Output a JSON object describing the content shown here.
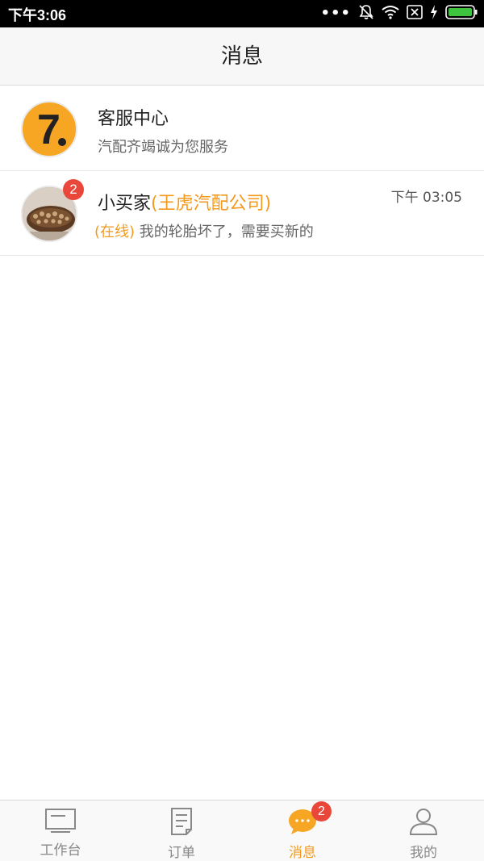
{
  "status_bar": {
    "time": "下午3:06",
    "icons": [
      "more-icon",
      "bell-muted-icon",
      "wifi-icon",
      "no-sim-icon",
      "charging-icon",
      "battery-icon"
    ]
  },
  "header": {
    "title": "消息"
  },
  "conversations": [
    {
      "name": "客服中心",
      "preview": "汽配齐竭诚为您服务",
      "avatar": "service-logo-icon"
    },
    {
      "name": "小买家",
      "company": "(王虎汽配公司)",
      "time": "下午 03:05",
      "online": "(在线)",
      "preview": "我的轮胎坏了，需要买新的",
      "unread": "2",
      "avatar": "user-avatar"
    }
  ],
  "tabs": [
    {
      "label": "工作台",
      "icon": "monitor-icon",
      "active": false
    },
    {
      "label": "订单",
      "icon": "document-icon",
      "active": false
    },
    {
      "label": "消息",
      "icon": "chat-bubble-icon",
      "active": true,
      "badge": "2"
    },
    {
      "label": "我的",
      "icon": "person-icon",
      "active": false
    }
  ],
  "colors": {
    "accent": "#f39a1e",
    "badge": "#e8473a",
    "logo_bg": "#f6a623"
  }
}
